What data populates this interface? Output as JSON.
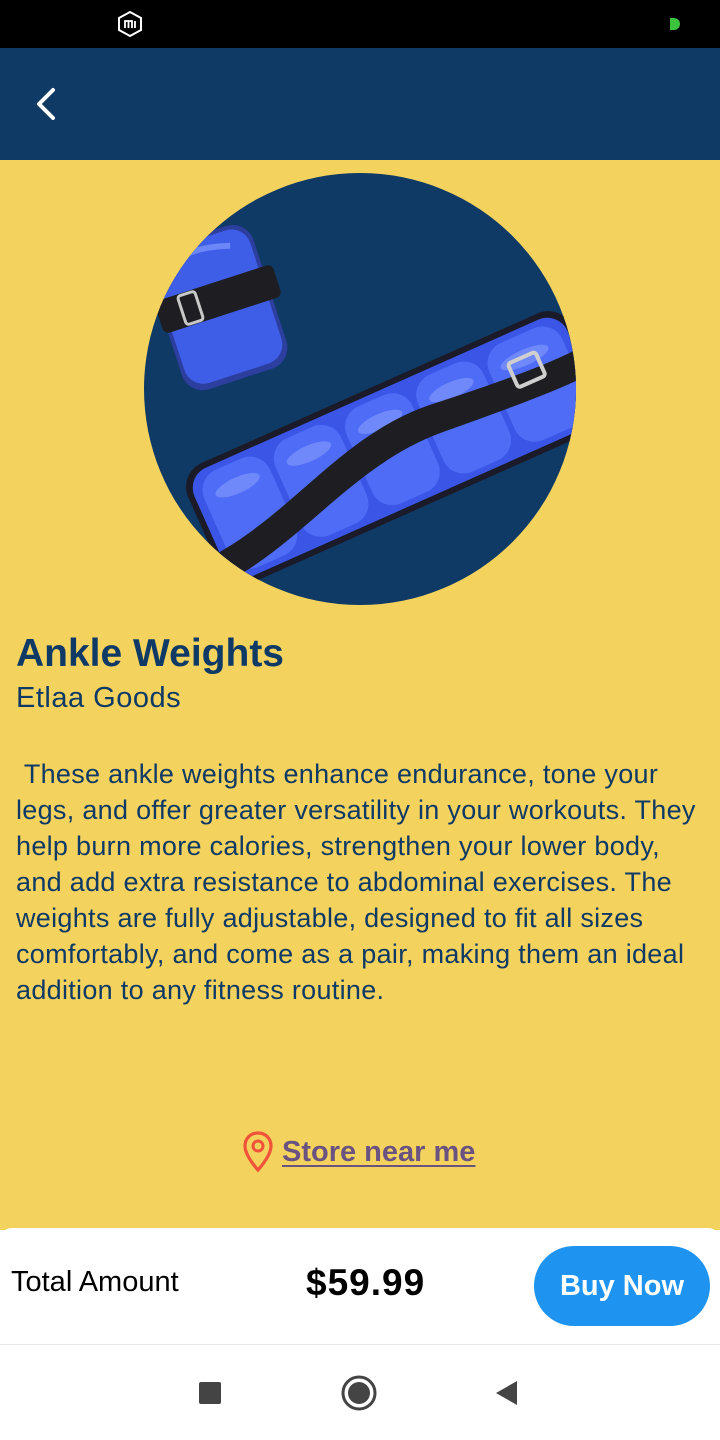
{
  "status_bar": {
    "left_icon": "mi-logo-icon",
    "right_icon": "green-dot-icon"
  },
  "app_bar": {
    "back_icon": "chevron-left-icon"
  },
  "product": {
    "image_name": "ankle-weights-image",
    "title": "Ankle Weights",
    "brand": "Etlaa Goods",
    "description": " These ankle weights enhance endurance, tone your legs, and offer greater versatility in your workouts. They help burn more calories, strengthen your lower body, and add extra resistance to abdominal exercises. The weights are fully adjustable, designed to fit all sizes comfortably, and come as a pair, making them an ideal addition to any fitness routine.",
    "store_link_label": "Store near me",
    "store_link_icon": "location-pin-icon"
  },
  "checkout": {
    "total_label": "Total Amount",
    "total_value": "$59.99",
    "buy_label": "Buy Now"
  },
  "nav_bar": {
    "recents_icon": "square-icon",
    "home_icon": "circle-icon",
    "back_icon": "triangle-back-icon"
  },
  "colors": {
    "app_bar": "#0f3a66",
    "background": "#f3d25e",
    "buy_button": "#1e94f0",
    "link": "#6a5380",
    "pin": "#f0523a"
  }
}
